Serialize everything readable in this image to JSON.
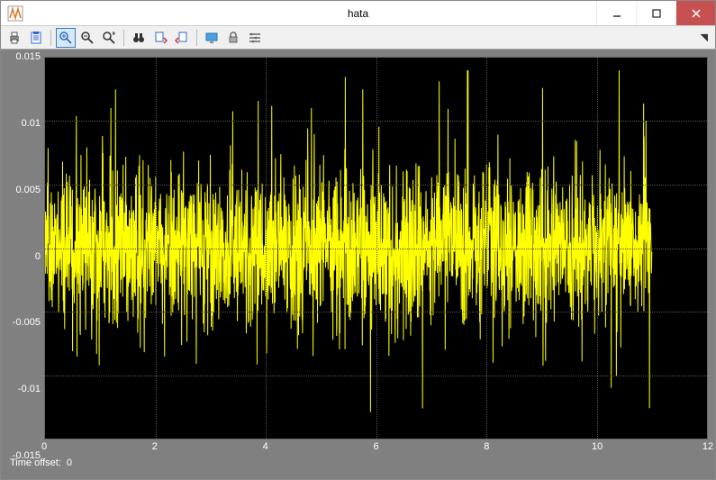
{
  "window": {
    "title": "hata"
  },
  "toolbar": {
    "buttons": [
      {
        "name": "print-icon",
        "glyph": "print"
      },
      {
        "name": "params-icon",
        "glyph": "clipboard"
      },
      {
        "sep": true
      },
      {
        "name": "zoom-in-icon",
        "glyph": "zoom-plus",
        "active": true
      },
      {
        "name": "zoom-x-icon",
        "glyph": "zoom-x"
      },
      {
        "name": "zoom-xy-icon",
        "glyph": "zoom-xy"
      },
      {
        "sep": true
      },
      {
        "name": "autoscale-icon",
        "glyph": "binoculars"
      },
      {
        "name": "save-config-icon",
        "glyph": "doc-save"
      },
      {
        "name": "restore-config-icon",
        "glyph": "doc-restore"
      },
      {
        "sep": true
      },
      {
        "name": "float-icon",
        "glyph": "monitor"
      },
      {
        "name": "lock-icon",
        "glyph": "lock"
      },
      {
        "name": "signal-select-icon",
        "glyph": "signals"
      }
    ]
  },
  "status": {
    "label": "Time offset:",
    "value": "0"
  },
  "chart_data": {
    "type": "line",
    "title": "",
    "xlabel": "",
    "ylabel": "",
    "xlim": [
      0,
      12
    ],
    "ylim": [
      -0.015,
      0.015
    ],
    "xticks": [
      0,
      2,
      4,
      6,
      8,
      10,
      12
    ],
    "yticks": [
      -0.015,
      -0.01,
      -0.005,
      0,
      0.005,
      0.01,
      0.015
    ],
    "ytick_labels": [
      "-0.015",
      "-0.01",
      "-0.005",
      "0",
      "0.005",
      "0.01",
      "0.015"
    ],
    "series": [
      {
        "name": "hata",
        "description": "dense noise-like error signal, approx 0–11 on x, roughly zero-mean, peak magnitude ~0.014, dense band ~±0.005",
        "x_data_range": [
          0,
          11
        ],
        "approx_std": 0.003,
        "approx_peak": 0.014,
        "color": "#ffff00"
      }
    ]
  }
}
